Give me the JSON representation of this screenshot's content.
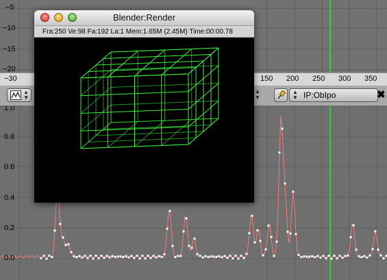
{
  "window": {
    "title": "Blender:Render",
    "stats": "Fra:250  Ve:98 Fa:192 La:1 Mem:1.65M (2.45M) Time:00:00.78"
  },
  "top_area": {
    "ylabels": [
      "−5",
      "−10",
      "−15",
      "−20"
    ]
  },
  "ruler": {
    "ticks": [
      "−30",
      "150",
      "200",
      "250",
      "300",
      "350"
    ]
  },
  "ipo_header": {
    "editor_icon": "ipo-curve-icon",
    "pin_icon": "pin-icon",
    "ipo_block_name": "IP:ObIpo",
    "close_glyph": "✖"
  },
  "ipo_area": {
    "ylabels": [
      "1.0",
      "0.8",
      "0.6",
      "0.4",
      "0.2",
      "0.0"
    ],
    "curve_color": "#f07c7c",
    "point_color": "#ffffff",
    "current_frame_color": "#2fd52f"
  },
  "render": {
    "wire_color": "#3ff23f",
    "subdivisions": 4
  }
}
